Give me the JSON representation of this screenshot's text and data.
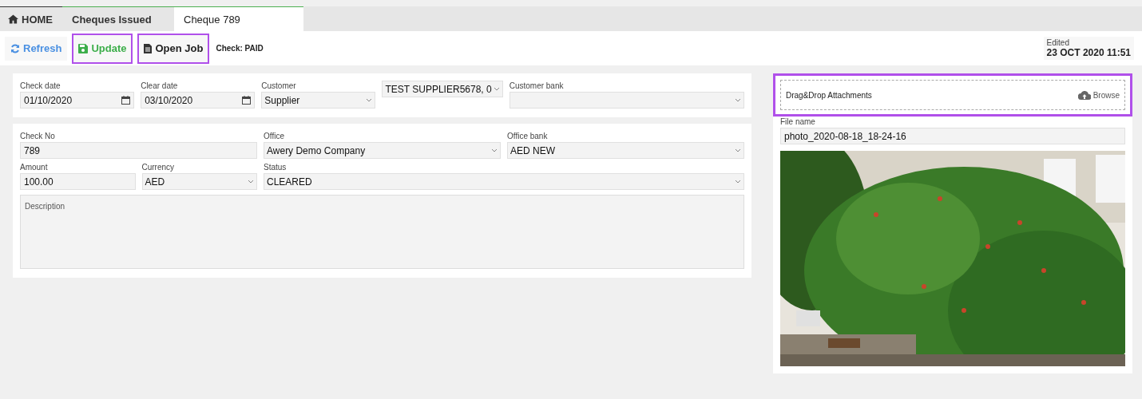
{
  "tabs": [
    {
      "label": "HOME",
      "kind": "home",
      "selected": false
    },
    {
      "label": "Cheques Issued",
      "kind": "plain",
      "selected": false
    },
    {
      "label": "Cheque 789",
      "kind": "plain",
      "selected": true
    }
  ],
  "toolbar": {
    "buttons": [
      {
        "label": "Refresh",
        "kind": "refresh",
        "highlighted": false
      },
      {
        "label": "Update",
        "kind": "update",
        "highlighted": true
      },
      {
        "label": "Open Job",
        "kind": "job",
        "highlighted": true
      }
    ],
    "status": "Check: PAID",
    "edited_label": "Edited",
    "edited_value": "23 OCT 2020 11:51"
  },
  "header_fields": [
    {
      "label": "Check date",
      "value": "01/10/2020",
      "kind": "date"
    },
    {
      "label": "Clear date",
      "value": "03/10/2020",
      "kind": "date"
    },
    {
      "label": "Customer",
      "value": "Supplier",
      "kind": "select"
    },
    {
      "value": "TEST SUPPLIER5678, 0",
      "kind": "select"
    },
    {
      "label": "Customer bank",
      "kind": "select"
    }
  ],
  "detail_fields": [
    {
      "label": "Check No",
      "value": "789",
      "kind": "text"
    },
    {
      "label": "Office",
      "value": "Awery Demo Company",
      "kind": "select"
    },
    {
      "label": "Office bank",
      "value": "AED NEW",
      "kind": "select"
    },
    {
      "label": "Amount",
      "value": "100.00",
      "kind": "text"
    },
    {
      "label": "Currency",
      "value": "AED",
      "kind": "select"
    },
    {
      "label": "Status",
      "value": "CLEARED",
      "kind": "select"
    },
    {
      "placeholder": "Description",
      "kind": "textarea"
    }
  ],
  "attachments": {
    "drop_label": "Drag&Drop Attachments",
    "browse": "Browse",
    "highlighted": true,
    "file_label": "File name",
    "file_value": "photo_2020-08-18_18-24-16"
  }
}
